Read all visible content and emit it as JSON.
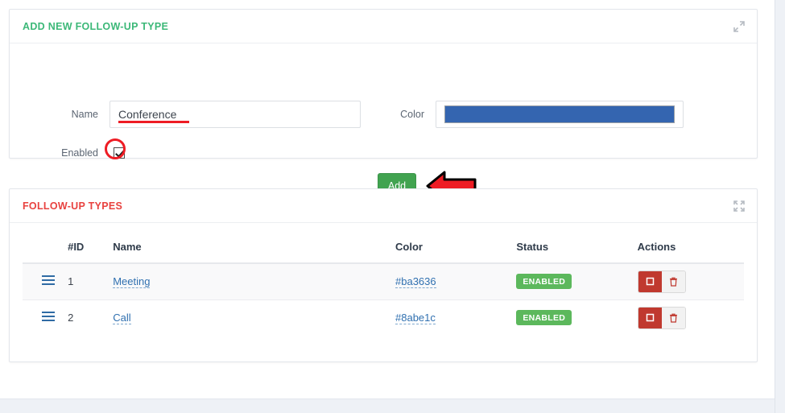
{
  "add_panel": {
    "title": "ADD NEW FOLLOW-UP TYPE",
    "title_color": "#3cb878",
    "collapse_icon": "collapse-diagonal-icon",
    "fields": {
      "name_label": "Name",
      "name_value": "Conference",
      "name_placeholder": "",
      "color_label": "Color",
      "color_value": "#3465b0",
      "enabled_label": "Enabled",
      "enabled_checked": true
    },
    "submit_label": "Add",
    "submit_color": "#41a350",
    "annotations": {
      "name_underline_color": "#ee1c24",
      "checkbox_circle_color": "#ee1c24",
      "arrow_color": "#ee1c24",
      "arrow_direction": "left"
    }
  },
  "list_panel": {
    "title": "FOLLOW-UP TYPES",
    "title_color": "#e8423f",
    "expand_icon": "fullscreen-expand-icon",
    "columns": [
      "",
      "#ID",
      "Name",
      "Color",
      "Status",
      "Actions"
    ],
    "rows": [
      {
        "handle": "drag-handle-icon",
        "id": "1",
        "name": "Meeting",
        "color": "#ba3636",
        "status": "ENABLED",
        "actions": [
          "disable-button",
          "delete-button"
        ]
      },
      {
        "handle": "drag-handle-icon",
        "id": "2",
        "name": "Call",
        "color": "#8abe1c",
        "status": "ENABLED",
        "actions": [
          "disable-button",
          "delete-button"
        ]
      }
    ]
  }
}
